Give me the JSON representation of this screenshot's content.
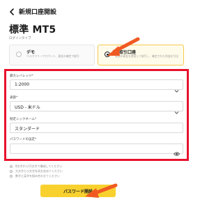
{
  "header": {
    "back_icon": "chevron-left-icon",
    "title": "新規口座開設"
  },
  "page_title": "標準 MT5",
  "login_type": {
    "label": "ログインタイプ",
    "options": [
      {
        "title": "デモ",
        "description": "リスクフリーアカウント、資金の確定で取引",
        "selected": false
      },
      {
        "title": "本取引口座",
        "description": "実際の資金を使用して取引し、確定された利益を引出",
        "selected": true
      }
    ]
  },
  "form": {
    "leverage": {
      "label": "最大レバレッジ*",
      "value": "1:2000"
    },
    "currency": {
      "label": "通貨*",
      "value": "USD - 米ドル"
    },
    "nickname": {
      "label": "勘定ニックネーム*",
      "value": "スタンダード"
    },
    "password": {
      "label": "パスワードの設定*",
      "value": ""
    }
  },
  "password_rules": [
    "8文字から15文字で構成してください",
    "大文字と小文字を両方含めてください",
    "数字と英字を組み合わせてください"
  ],
  "submit_label": "パスワード開設",
  "colors": {
    "accent": "#f8d12f",
    "highlight": "#e8112d",
    "arrow": "#f05a22"
  }
}
